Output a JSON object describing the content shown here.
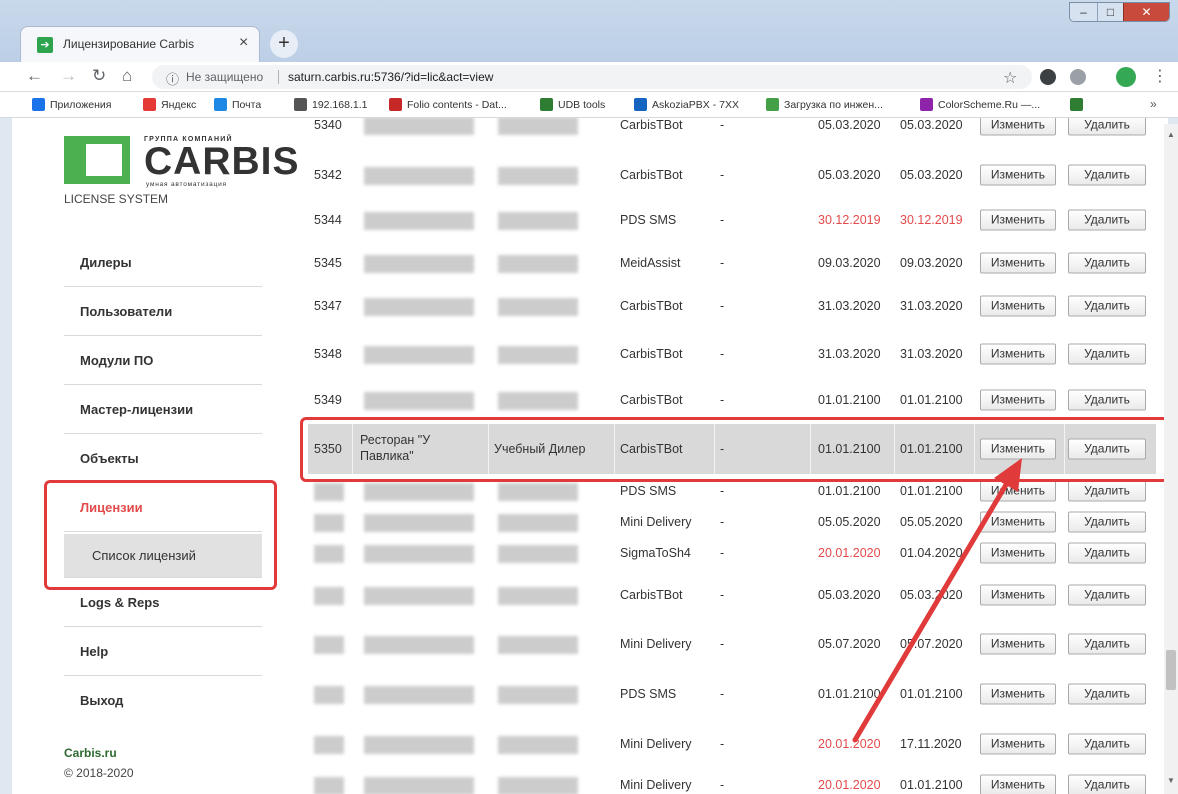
{
  "browser": {
    "tab_title": "Лицензирование Carbis",
    "tab_close": "×",
    "new_tab": "+",
    "insecure_label": "Не защищено",
    "url": "saturn.carbis.ru:5736/?id=lic&act=view",
    "window_min": "–",
    "window_max": "□",
    "window_close": "✕",
    "bookmarks": [
      {
        "label": "Приложения",
        "color": "#1a73e8"
      },
      {
        "label": "Яндекс",
        "color": "#e53935"
      },
      {
        "label": "Почта",
        "color": "#1e88e5"
      },
      {
        "label": "192.168.1.1",
        "color": "#555555"
      },
      {
        "label": "Folio contents - Dat...",
        "color": "#c62828"
      },
      {
        "label": "UDB tools",
        "color": "#2e7d32"
      },
      {
        "label": "AskoziaPBX - 7XX",
        "color": "#1565c0"
      },
      {
        "label": "Загрузка по инжен...",
        "color": "#43a047"
      },
      {
        "label": "ColorScheme.Ru —...",
        "color": "#8e24aa"
      },
      {
        "label": "",
        "color": "#2e7d32"
      }
    ],
    "bookmarks_more": "»"
  },
  "sidebar": {
    "logo_group": "ГРУППА КОМПАНИЙ",
    "logo_word": "CARBIS",
    "logo_slogan": "умная автоматизация",
    "license_system": "LICENSE SYSTEM",
    "menu": [
      "Дилеры",
      "Пользователи",
      "Модули ПО",
      "Мастер-лицензии",
      "Объекты",
      "Лицензии"
    ],
    "submenu": "Список лицензий",
    "menu_after": [
      "Logs & Reps",
      "Help",
      "Выход"
    ],
    "footer_link": "Carbis.ru",
    "footer_copy": "© 2018-2020"
  },
  "table": {
    "edit_label": "Изменить",
    "delete_label": "Удалить",
    "rows": [
      {
        "id": "5340",
        "module": "CarbisTBot",
        "dash": "-",
        "d1": "05.03.2020",
        "d2": "05.03.2020"
      },
      {
        "id": "5342",
        "module": "CarbisTBot",
        "dash": "-",
        "d1": "05.03.2020",
        "d2": "05.03.2020"
      },
      {
        "id": "5344",
        "module": "PDS SMS",
        "dash": "-",
        "d1": "30.12.2019",
        "d2": "30.12.2019",
        "red1": true,
        "red2": true
      },
      {
        "id": "5345",
        "module": "MeidAssist",
        "dash": "-",
        "d1": "09.03.2020",
        "d2": "09.03.2020"
      },
      {
        "id": "5347",
        "module": "CarbisTBot",
        "dash": "-",
        "d1": "31.03.2020",
        "d2": "31.03.2020"
      },
      {
        "id": "5348",
        "module": "CarbisTBot",
        "dash": "-",
        "d1": "31.03.2020",
        "d2": "31.03.2020"
      },
      {
        "id": "5349",
        "module": "CarbisTBot",
        "dash": "-",
        "d1": "01.01.2100",
        "d2": "01.01.2100"
      },
      {
        "id": "5350",
        "name": "Ресторан \"У Павлика\"",
        "dealer": "Учебный Дилер",
        "module": "CarbisTBot",
        "dash": "-",
        "d1": "01.01.2100",
        "d2": "01.01.2100",
        "selected": true
      },
      {
        "id": "",
        "module": "PDS SMS",
        "dash": "-",
        "d1": "01.01.2100",
        "d2": "01.01.2100"
      },
      {
        "id": "",
        "module": "Mini Delivery",
        "dash": "-",
        "d1": "05.05.2020",
        "d2": "05.05.2020"
      },
      {
        "id": "",
        "module": "SigmaToSh4",
        "dash": "-",
        "d1": "20.01.2020",
        "d2": "01.04.2020",
        "red1": true
      },
      {
        "id": "",
        "module": "CarbisTBot",
        "dash": "-",
        "d1": "05.03.2020",
        "d2": "05.03.2020"
      },
      {
        "id": "",
        "module": "Mini Delivery",
        "dash": "-",
        "d1": "05.07.2020",
        "d2": "05.07.2020"
      },
      {
        "id": "",
        "module": "PDS SMS",
        "dash": "-",
        "d1": "01.01.2100",
        "d2": "01.01.2100"
      },
      {
        "id": "",
        "module": "Mini Delivery",
        "dash": "-",
        "d1": "20.01.2020",
        "d2": "17.11.2020",
        "red1": true
      },
      {
        "id": "",
        "module": "Mini Delivery",
        "dash": "-",
        "d1": "20.01.2020",
        "d2": "01.01.2100",
        "red1": true
      }
    ]
  },
  "colors": {
    "accent_red": "#e34b4b",
    "annotation_red": "#e03a3a",
    "brand_green": "#4caf50"
  }
}
